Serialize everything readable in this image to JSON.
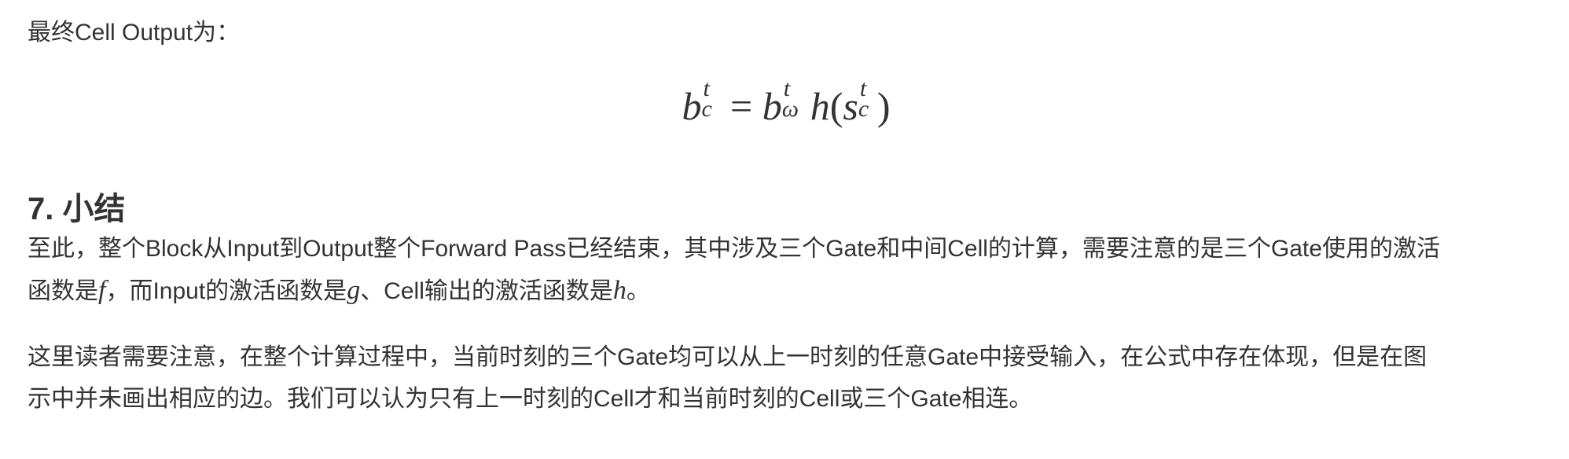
{
  "intro_text": "最终Cell Output为：",
  "formula": {
    "lhs_base": "b",
    "lhs_sup": "t",
    "lhs_sub": "c",
    "equals": "=",
    "rhs_base": "b",
    "rhs_sup": "t",
    "rhs_sub": "ω",
    "func": "h",
    "open_paren": "(",
    "arg_base": "s",
    "arg_sup": "t",
    "arg_sub": "c",
    "close_paren": ")"
  },
  "section_heading": "7. 小结",
  "paragraph1": {
    "line1": "至此，整个Block从Input到Output整个Forward Pass已经结束，其中涉及三个Gate和中间Cell的计算，需要注意的是三个Gate使用的激活",
    "line2_a": "函数是",
    "math_f": "f",
    "line2_b": "，而Input的激活函数是",
    "math_g": "g",
    "line2_c": "、Cell输出的激活函数是",
    "math_h": "h",
    "line2_d": "。"
  },
  "paragraph2": {
    "line1": "这里读者需要注意，在整个计算过程中，当前时刻的三个Gate均可以从上一时刻的任意Gate中接受输入，在公式中存在体现，但是在图",
    "line2": "示中并未画出相应的边。我们可以认为只有上一时刻的Cell才和当前时刻的Cell或三个Gate相连。"
  }
}
